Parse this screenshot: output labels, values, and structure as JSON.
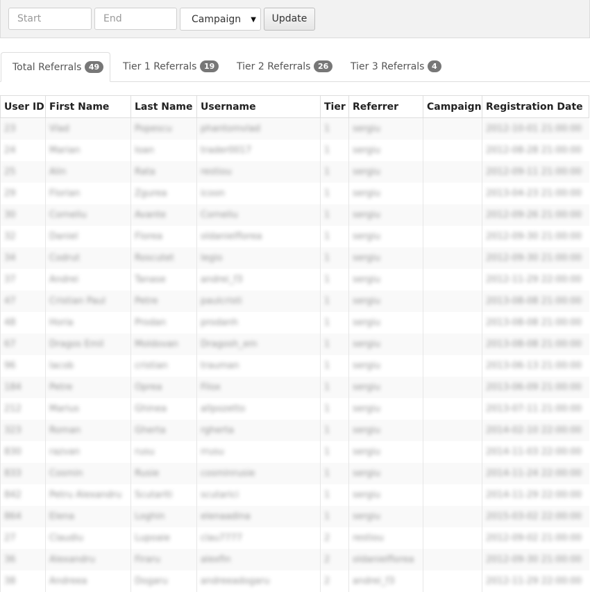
{
  "filters": {
    "start_placeholder": "Start",
    "end_placeholder": "End",
    "campaign_label": "Campaign",
    "update_label": "Update"
  },
  "tabs": [
    {
      "label": "Total Referrals",
      "count": "49",
      "active": true
    },
    {
      "label": "Tier 1 Referrals",
      "count": "19",
      "active": false
    },
    {
      "label": "Tier 2 Referrals",
      "count": "26",
      "active": false
    },
    {
      "label": "Tier 3 Referrals",
      "count": "4",
      "active": false
    }
  ],
  "table": {
    "columns": [
      "User ID",
      "First Name",
      "Last Name",
      "Username",
      "Tier",
      "Referrer",
      "Campaign",
      "Registration Date"
    ],
    "rows": [
      [
        "23",
        "Vlad",
        "Popescu",
        "phantomvlad",
        "1",
        "sergiu",
        "",
        "2012-10-01 21:00:00"
      ],
      [
        "24",
        "Marian",
        "Ioan",
        "trader0017",
        "1",
        "sergiu",
        "",
        "2012-08-28 21:00:00"
      ],
      [
        "25",
        "Alin",
        "Rata",
        "restiou",
        "1",
        "sergiu",
        "",
        "2012-09-11 21:00:00"
      ],
      [
        "29",
        "Florian",
        "Zgurea",
        "icoon",
        "1",
        "sergiu",
        "",
        "2013-04-23 21:00:00"
      ],
      [
        "30",
        "Corneliu",
        "Avante",
        "Corneliu",
        "1",
        "sergiu",
        "",
        "2012-09-26 21:00:00"
      ],
      [
        "32",
        "Daniel",
        "Florea",
        "oldanielflorea",
        "1",
        "sergiu",
        "",
        "2012-09-30 21:00:00"
      ],
      [
        "34",
        "Codrut",
        "Roscutet",
        "legio",
        "1",
        "sergiu",
        "",
        "2012-09-30 21:00:00"
      ],
      [
        "37",
        "Andrei",
        "Tanase",
        "andrei_f3",
        "1",
        "sergiu",
        "",
        "2012-11-29 22:00:00"
      ],
      [
        "47",
        "Cristian Paul",
        "Petre",
        "paulcristi",
        "1",
        "sergiu",
        "",
        "2013-08-08 21:00:00"
      ],
      [
        "48",
        "Horia",
        "Prodan",
        "prodanh",
        "1",
        "sergiu",
        "",
        "2013-08-08 21:00:00"
      ],
      [
        "67",
        "Dragos Emil",
        "Moldovan",
        "Dragosh_em",
        "1",
        "sergiu",
        "",
        "2013-08-08 21:00:00"
      ],
      [
        "96",
        "Iacob",
        "cristian",
        "trauman",
        "1",
        "sergiu",
        "",
        "2013-06-13 21:00:00"
      ],
      [
        "184",
        "Petre",
        "Oprea",
        "Filox",
        "1",
        "sergiu",
        "",
        "2013-06-09 21:00:00"
      ],
      [
        "212",
        "Marius",
        "Ghinea",
        "allpozetto",
        "1",
        "sergiu",
        "",
        "2013-07-11 21:00:00"
      ],
      [
        "323",
        "Roman",
        "Gherta",
        "rgherta",
        "1",
        "sergiu",
        "",
        "2014-02-10 22:00:00"
      ],
      [
        "830",
        "razvan",
        "rusu",
        "rrusu",
        "1",
        "sergiu",
        "",
        "2014-11-03 22:00:00"
      ],
      [
        "833",
        "Cosmin",
        "Rusie",
        "cosminrusie",
        "1",
        "sergiu",
        "",
        "2014-11-24 22:00:00"
      ],
      [
        "842",
        "Petru Alexandru",
        "Scutariti",
        "scutarici",
        "1",
        "sergiu",
        "",
        "2014-11-29 22:00:00"
      ],
      [
        "864",
        "Elena",
        "Loghin",
        "elenaadina",
        "1",
        "sergiu",
        "",
        "2015-03-02 22:00:00"
      ],
      [
        "27",
        "Claudiu",
        "Lupoaie",
        "clau7777",
        "2",
        "restiou",
        "",
        "2012-09-02 21:00:00"
      ],
      [
        "36",
        "Alexandru",
        "Firaru",
        "alexfin",
        "2",
        "oldanielflorea",
        "",
        "2012-09-30 21:00:00"
      ],
      [
        "38",
        "Andreea",
        "Dogaru",
        "andreeadogaru",
        "2",
        "andrei_f3",
        "",
        "2012-11-29 22:00:00"
      ]
    ]
  }
}
